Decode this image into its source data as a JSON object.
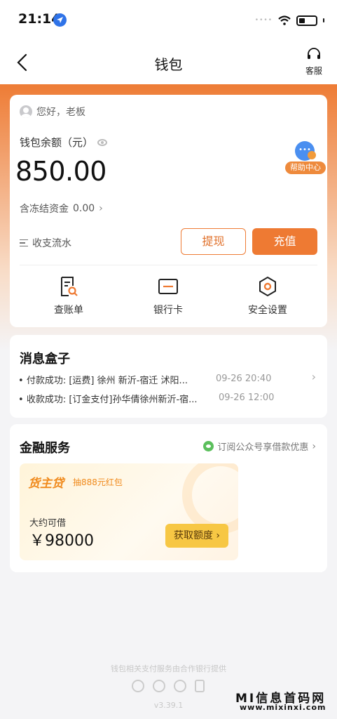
{
  "status_bar": {
    "time": "21:14",
    "signal": "•••• "
  },
  "nav": {
    "title": "钱包",
    "service_label": "客服"
  },
  "wallet": {
    "greeting": "您好，老板",
    "balance_label": "钱包余额（元）",
    "balance": "850.00",
    "frozen_label": "含冻结资金",
    "frozen_value": "0.00",
    "help_center": "帮助中心",
    "flow_label": "收支流水",
    "withdraw": "提现",
    "recharge": "充值",
    "quick_actions": [
      {
        "label": "查账单",
        "icon": "bill-icon"
      },
      {
        "label": "银行卡",
        "icon": "bank-card-icon"
      },
      {
        "label": "安全设置",
        "icon": "security-icon"
      }
    ],
    "accent_color": "#ee7a33"
  },
  "messages": {
    "title": "消息盒子",
    "items": [
      {
        "text": "付款成功: [运费] 徐州 新沂-宿迁 沭阳...",
        "time": "09-26 20:40"
      },
      {
        "text": "收款成功: [订金支付]孙华倩徐州新沂-宿...",
        "time": "09-26 12:00"
      }
    ]
  },
  "finance": {
    "title": "金融服务",
    "subscribe_link": "订阅公众号享借款优惠",
    "loan_brand": "货主贷",
    "loan_promo": "抽888元红包",
    "loan_label": "大约可借",
    "loan_amount": "￥98000",
    "loan_button": "获取额度"
  },
  "footer": {
    "provider_text": "钱包相关支付服务由合作银行提供",
    "version": "v3.39.1"
  },
  "watermark": {
    "text": "MI信息首码网",
    "url": "www.mixinxi.com"
  }
}
